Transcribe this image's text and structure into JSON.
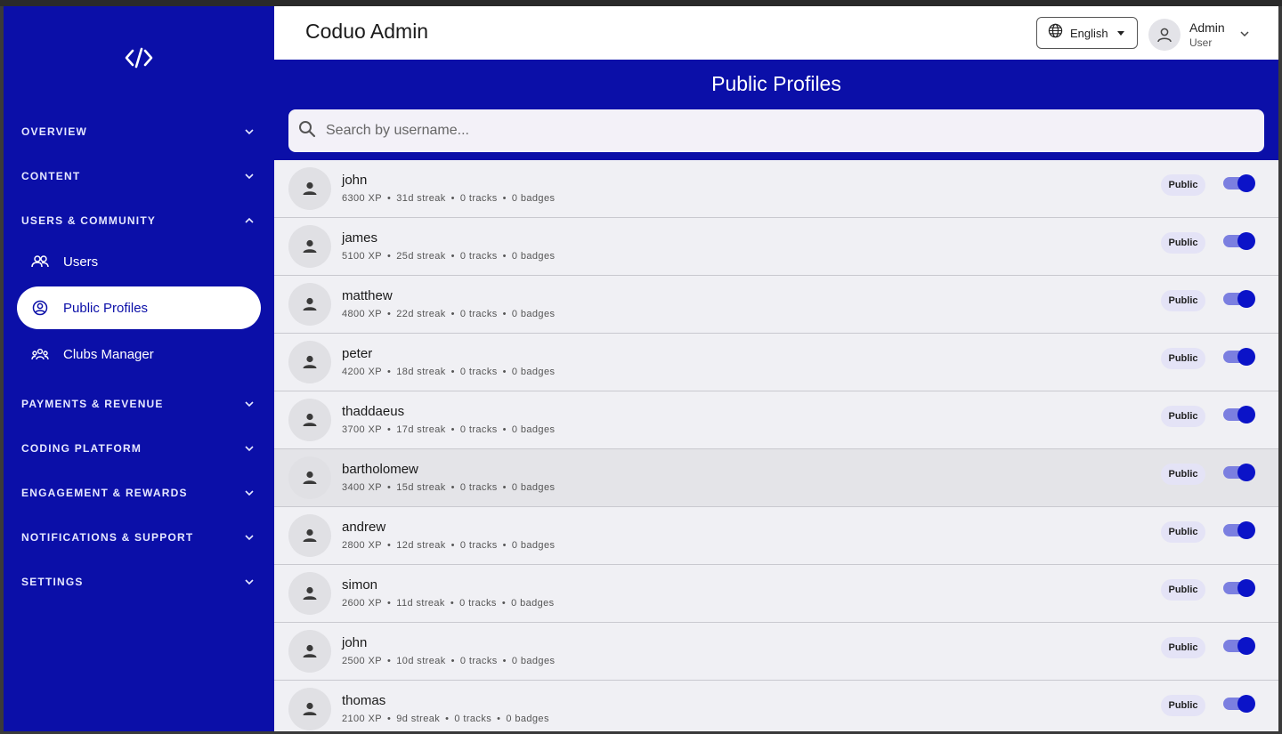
{
  "sidebar": {
    "sections": [
      {
        "label": "OVERVIEW",
        "expanded": false
      },
      {
        "label": "CONTENT",
        "expanded": false
      },
      {
        "label": "USERS & COMMUNITY",
        "expanded": true
      },
      {
        "label": "PAYMENTS & REVENUE",
        "expanded": false
      },
      {
        "label": "CODING PLATFORM",
        "expanded": false
      },
      {
        "label": "ENGAGEMENT & REWARDS",
        "expanded": false
      },
      {
        "label": "NOTIFICATIONS & SUPPORT",
        "expanded": false
      },
      {
        "label": "SETTINGS",
        "expanded": false
      }
    ],
    "sub_items": [
      {
        "label": "Users",
        "icon": "users-icon"
      },
      {
        "label": "Public Profiles",
        "icon": "account-circle-icon",
        "active": true
      },
      {
        "label": "Clubs Manager",
        "icon": "groups-icon"
      }
    ]
  },
  "header": {
    "title": "Coduo Admin",
    "language": "English",
    "user_name": "Admin",
    "user_role": "User"
  },
  "page": {
    "title": "Public Profiles",
    "search_placeholder": "Search by username..."
  },
  "profiles": [
    {
      "name": "john",
      "xp": "6300 XP",
      "streak": "31d streak",
      "tracks": "0 tracks",
      "badges": "0 badges",
      "status": "Public",
      "enabled": true
    },
    {
      "name": "james",
      "xp": "5100 XP",
      "streak": "25d streak",
      "tracks": "0 tracks",
      "badges": "0 badges",
      "status": "Public",
      "enabled": true
    },
    {
      "name": "matthew",
      "xp": "4800 XP",
      "streak": "22d streak",
      "tracks": "0 tracks",
      "badges": "0 badges",
      "status": "Public",
      "enabled": true
    },
    {
      "name": "peter",
      "xp": "4200 XP",
      "streak": "18d streak",
      "tracks": "0 tracks",
      "badges": "0 badges",
      "status": "Public",
      "enabled": true
    },
    {
      "name": "thaddaeus",
      "xp": "3700 XP",
      "streak": "17d streak",
      "tracks": "0 tracks",
      "badges": "0 badges",
      "status": "Public",
      "enabled": true
    },
    {
      "name": "bartholomew",
      "xp": "3400 XP",
      "streak": "15d streak",
      "tracks": "0 tracks",
      "badges": "0 badges",
      "status": "Public",
      "enabled": true
    },
    {
      "name": "andrew",
      "xp": "2800 XP",
      "streak": "12d streak",
      "tracks": "0 tracks",
      "badges": "0 badges",
      "status": "Public",
      "enabled": true
    },
    {
      "name": "simon",
      "xp": "2600 XP",
      "streak": "11d streak",
      "tracks": "0 tracks",
      "badges": "0 badges",
      "status": "Public",
      "enabled": true
    },
    {
      "name": "john",
      "xp": "2500 XP",
      "streak": "10d streak",
      "tracks": "0 tracks",
      "badges": "0 badges",
      "status": "Public",
      "enabled": true
    },
    {
      "name": "thomas",
      "xp": "2100 XP",
      "streak": "9d streak",
      "tracks": "0 tracks",
      "badges": "0 badges",
      "status": "Public",
      "enabled": true
    }
  ],
  "colors": {
    "primary": "#0b0fa8",
    "toggle_track": "#7b7fe0",
    "badge_bg": "#e4e3f6"
  }
}
